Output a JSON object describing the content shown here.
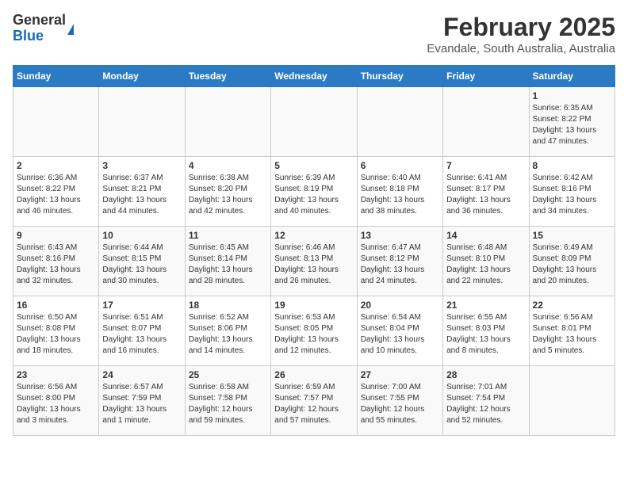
{
  "logo": {
    "general": "General",
    "blue": "Blue"
  },
  "title": "February 2025",
  "subtitle": "Evandale, South Australia, Australia",
  "days_of_week": [
    "Sunday",
    "Monday",
    "Tuesday",
    "Wednesday",
    "Thursday",
    "Friday",
    "Saturday"
  ],
  "weeks": [
    [
      {
        "day": "",
        "info": ""
      },
      {
        "day": "",
        "info": ""
      },
      {
        "day": "",
        "info": ""
      },
      {
        "day": "",
        "info": ""
      },
      {
        "day": "",
        "info": ""
      },
      {
        "day": "",
        "info": ""
      },
      {
        "day": "1",
        "info": "Sunrise: 6:35 AM\nSunset: 8:22 PM\nDaylight: 13 hours\nand 47 minutes."
      }
    ],
    [
      {
        "day": "2",
        "info": "Sunrise: 6:36 AM\nSunset: 8:22 PM\nDaylight: 13 hours\nand 46 minutes."
      },
      {
        "day": "3",
        "info": "Sunrise: 6:37 AM\nSunset: 8:21 PM\nDaylight: 13 hours\nand 44 minutes."
      },
      {
        "day": "4",
        "info": "Sunrise: 6:38 AM\nSunset: 8:20 PM\nDaylight: 13 hours\nand 42 minutes."
      },
      {
        "day": "5",
        "info": "Sunrise: 6:39 AM\nSunset: 8:19 PM\nDaylight: 13 hours\nand 40 minutes."
      },
      {
        "day": "6",
        "info": "Sunrise: 6:40 AM\nSunset: 8:18 PM\nDaylight: 13 hours\nand 38 minutes."
      },
      {
        "day": "7",
        "info": "Sunrise: 6:41 AM\nSunset: 8:17 PM\nDaylight: 13 hours\nand 36 minutes."
      },
      {
        "day": "8",
        "info": "Sunrise: 6:42 AM\nSunset: 8:16 PM\nDaylight: 13 hours\nand 34 minutes."
      }
    ],
    [
      {
        "day": "9",
        "info": "Sunrise: 6:43 AM\nSunset: 8:16 PM\nDaylight: 13 hours\nand 32 minutes."
      },
      {
        "day": "10",
        "info": "Sunrise: 6:44 AM\nSunset: 8:15 PM\nDaylight: 13 hours\nand 30 minutes."
      },
      {
        "day": "11",
        "info": "Sunrise: 6:45 AM\nSunset: 8:14 PM\nDaylight: 13 hours\nand 28 minutes."
      },
      {
        "day": "12",
        "info": "Sunrise: 6:46 AM\nSunset: 8:13 PM\nDaylight: 13 hours\nand 26 minutes."
      },
      {
        "day": "13",
        "info": "Sunrise: 6:47 AM\nSunset: 8:12 PM\nDaylight: 13 hours\nand 24 minutes."
      },
      {
        "day": "14",
        "info": "Sunrise: 6:48 AM\nSunset: 8:10 PM\nDaylight: 13 hours\nand 22 minutes."
      },
      {
        "day": "15",
        "info": "Sunrise: 6:49 AM\nSunset: 8:09 PM\nDaylight: 13 hours\nand 20 minutes."
      }
    ],
    [
      {
        "day": "16",
        "info": "Sunrise: 6:50 AM\nSunset: 8:08 PM\nDaylight: 13 hours\nand 18 minutes."
      },
      {
        "day": "17",
        "info": "Sunrise: 6:51 AM\nSunset: 8:07 PM\nDaylight: 13 hours\nand 16 minutes."
      },
      {
        "day": "18",
        "info": "Sunrise: 6:52 AM\nSunset: 8:06 PM\nDaylight: 13 hours\nand 14 minutes."
      },
      {
        "day": "19",
        "info": "Sunrise: 6:53 AM\nSunset: 8:05 PM\nDaylight: 13 hours\nand 12 minutes."
      },
      {
        "day": "20",
        "info": "Sunrise: 6:54 AM\nSunset: 8:04 PM\nDaylight: 13 hours\nand 10 minutes."
      },
      {
        "day": "21",
        "info": "Sunrise: 6:55 AM\nSunset: 8:03 PM\nDaylight: 13 hours\nand 8 minutes."
      },
      {
        "day": "22",
        "info": "Sunrise: 6:56 AM\nSunset: 8:01 PM\nDaylight: 13 hours\nand 5 minutes."
      }
    ],
    [
      {
        "day": "23",
        "info": "Sunrise: 6:56 AM\nSunset: 8:00 PM\nDaylight: 13 hours\nand 3 minutes."
      },
      {
        "day": "24",
        "info": "Sunrise: 6:57 AM\nSunset: 7:59 PM\nDaylight: 13 hours\nand 1 minute."
      },
      {
        "day": "25",
        "info": "Sunrise: 6:58 AM\nSunset: 7:58 PM\nDaylight: 12 hours\nand 59 minutes."
      },
      {
        "day": "26",
        "info": "Sunrise: 6:59 AM\nSunset: 7:57 PM\nDaylight: 12 hours\nand 57 minutes."
      },
      {
        "day": "27",
        "info": "Sunrise: 7:00 AM\nSunset: 7:55 PM\nDaylight: 12 hours\nand 55 minutes."
      },
      {
        "day": "28",
        "info": "Sunrise: 7:01 AM\nSunset: 7:54 PM\nDaylight: 12 hours\nand 52 minutes."
      },
      {
        "day": "",
        "info": ""
      }
    ]
  ]
}
